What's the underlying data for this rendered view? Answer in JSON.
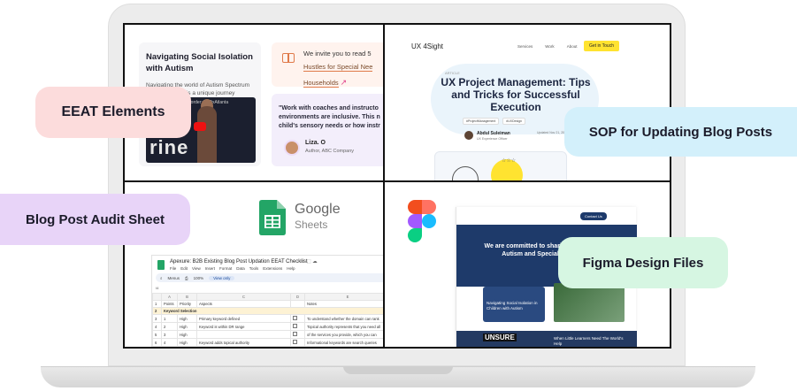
{
  "panel_eeat": {
    "card_title": "Navigating Social Isolation with Autism",
    "card_sub": "Navigating the world of Autism Spectrum Disorder (ASD) is a unique journey",
    "video_caption": "Autism Spectrum Disorder: TEDxAtlanta",
    "video_big_text": "rine",
    "quote1_lead": "We invite you to read 5",
    "quote1_link1": "Hustles for Special Nee",
    "quote1_link2": "Households",
    "quote2_lines": [
      "\"Work with coaches and instructo",
      "environments are inclusive. This n",
      "child's sensory needs or how instr"
    ],
    "quote2_name": "Liza. O",
    "quote2_role": "Author, ABC Company"
  },
  "panel_sop": {
    "logo": "UX 4Sight",
    "nav": [
      "Services",
      "Work",
      "About",
      "Blog"
    ],
    "cta": "Get in Touch",
    "tag": "ARTICLE",
    "title": "UX Project Management: Tips and Tricks for Successful Execution",
    "chips": [
      "#ProjectManagement",
      "#UXDesign"
    ],
    "author_name": "Abdul Suleiman",
    "author_meta": "UX Experience Officer",
    "updated": "Updated Nov 21, 2023"
  },
  "panel_audit": {
    "google": "Google",
    "sheets": "Sheets",
    "sheet_title": "Apexure: B2B Existing Blog Post Updation EEAT Checklist",
    "menu": [
      "File",
      "Edit",
      "View",
      "Insert",
      "Format",
      "Data",
      "Tools",
      "Extensions",
      "Help"
    ],
    "toolbar_search": "Menus",
    "toolbar_zoom": "100%",
    "toolbar_view": "View only",
    "cell_ref": "I4",
    "col_letters": [
      "",
      "A",
      "B",
      "C",
      "D",
      "E"
    ],
    "header_row": [
      "1",
      "Points",
      "Priority",
      "Aspects",
      "",
      "Notes"
    ],
    "section_row": [
      "2",
      "Keyword Selection",
      "",
      "",
      "",
      ""
    ],
    "rows": [
      [
        "3",
        "1",
        "High",
        "Primary keyword defined",
        "",
        "To understand whether the domain can rank"
      ],
      [
        "4",
        "2",
        "High",
        "Keyword is within DR range",
        "",
        "Topical authority represents that you need all"
      ],
      [
        "5",
        "3",
        "High",
        "",
        "",
        "of the services you provide, which you can"
      ],
      [
        "6",
        "4",
        "High",
        "Keyword adds topical authority",
        "",
        "Informational keywords are search queries"
      ]
    ]
  },
  "panel_figma": {
    "cta": "Contact Us",
    "hero": "We are committed to sharing blogs on Autism and Special Needs",
    "card": "Navigating Social Isolation in Children with Autism",
    "band_word": "UNSURE",
    "band_text": "When Little Learners Need The World's Help"
  },
  "pills": {
    "eeat": "EEAT Elements",
    "sop": "SOP for Updating Blog Posts",
    "audit": "Blog Post Audit Sheet",
    "figma": "Figma Design Files"
  },
  "colors": {
    "eeat_pill": "#fcdcdc",
    "sop_pill": "#d3f0fb",
    "audit_pill": "#e8d4f8",
    "figma_pill": "#d6f6e2",
    "sheets_green": "#23a566",
    "brand_yellow": "#ffe330",
    "navy": "#1e3a6a"
  }
}
